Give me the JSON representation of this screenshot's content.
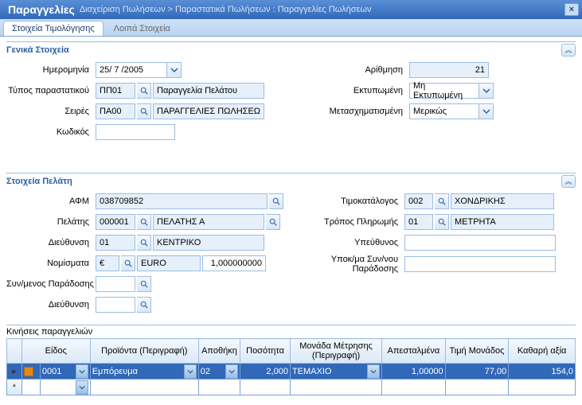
{
  "titlebar": {
    "title": "Παραγγελίες",
    "breadcrumb": "Διαχείριση Πωλήσεων > Παραστατικά Πωλήσεων : Παραγγελίες Πωλήσεων"
  },
  "tabs": {
    "billing": "Στοιχεία Τιμολόγησης",
    "other": "Λοιπά Στοιχεία"
  },
  "general": {
    "title": "Γενικά Στοιχεία",
    "date_label": "Ημερομηνία",
    "date_value": "25/ 7 /2005",
    "doc_type_label": "Τύπος παραστατικού",
    "doc_type_code": "ΠΠ01",
    "doc_type_desc": "Παραγγελία Πελάτου",
    "series_label": "Σειρές",
    "series_code": "ΠΑ00",
    "series_desc": "ΠΑΡΑΓΓΕΛΙΕΣ ΠΩΛΗΣΕΩΝ",
    "code_label": "Κωδικός",
    "code_value": "",
    "numbering_label": "Αρίθμηση",
    "numbering_value": "21",
    "printed_label": "Εκτυπωμένη",
    "printed_value": "Μη Εκτυπωμένη",
    "transformed_label": "Μετασχηματισμένη",
    "transformed_value": "Μερικώς"
  },
  "customer": {
    "title": "Στοιχεία Πελάτη",
    "vat_label": "ΑΦΜ",
    "vat_value": "038709852",
    "customer_label": "Πελάτης",
    "customer_code": "000001",
    "customer_desc": "ΠΕΛΑΤΗΣ Α",
    "address_label": "Διεύθυνση",
    "address_code": "01",
    "address_desc": "ΚΕΝΤΡΙΚΟ",
    "currency_label": "Νομίσματα",
    "currency_code": "€",
    "currency_desc": "EURO",
    "currency_rate": "1,000000000",
    "delivery_label": "Συν/μενος Παράδοσης",
    "delivery_value": "",
    "address2_label": "Διεύθυνση",
    "address2_value": "",
    "pricelist_label": "Τιμοκατάλογος",
    "pricelist_code": "002",
    "pricelist_desc": "ΧΟΝΔΡΙΚΗΣ",
    "payment_label": "Τρόπος Πληρωμής",
    "payment_code": "01",
    "payment_desc": "ΜΕΤΡΗΤΑ",
    "responsible_label": "Υπεύθυνος",
    "responsible_value": "",
    "branch_label": "Υποκ/μα Συν/νου Παράδοσης",
    "branch_value": ""
  },
  "grid": {
    "title": "Κινήσεις παραγγελιών",
    "headers": {
      "kind": "Είδος",
      "product": "Προϊόντα (Περιγραφή)",
      "warehouse": "Αποθήκη",
      "quantity": "Ποσότητα",
      "unit": "Μονάδα Μέτρησης (Περιγραφή)",
      "sent": "Απεσταλμένα",
      "unit_price": "Τιμή Μονάδος",
      "net_value": "Καθαρή αξία"
    },
    "rows": [
      {
        "kind_code": "0001",
        "product": "Εμπόρευμα",
        "warehouse": "02",
        "quantity": "2,000",
        "unit": "ΤΕΜΑΧΙΟ",
        "sent": "1,00000",
        "unit_price": "77,00",
        "net_value": "154,0"
      }
    ]
  }
}
